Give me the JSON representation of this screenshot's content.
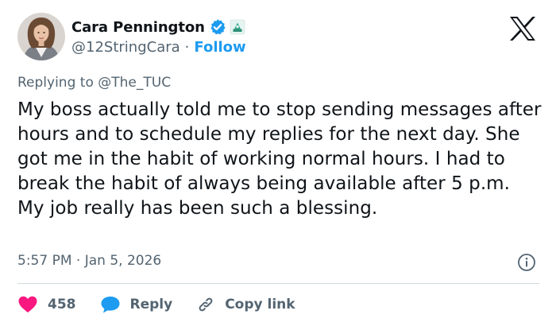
{
  "author": {
    "display_name": "Cara Pennington",
    "handle": "@12StringCara",
    "separator": "·",
    "follow_label": "Follow",
    "verified_color": "#1d9bf0"
  },
  "tweet": {
    "replying_prefix": "Replying to",
    "replying_handle": "@The_TUC",
    "text": "My boss actually told me to stop sending messages after hours and to schedule my replies for the next day. She got me in the habit of working normal hours. I had to break the habit of always being available after 5 p.m. My job really has been such a blessing.",
    "time": "5:57 PM",
    "meta_separator": "·",
    "date": "Jan 5, 2026"
  },
  "actions": {
    "like_count": "458",
    "reply_label": "Reply",
    "copy_label": "Copy link"
  },
  "icons": {
    "logo": "x-logo-icon",
    "verified": "verified-badge-icon",
    "affiliate": "affiliate-badge-icon",
    "info": "info-icon",
    "like": "heart-icon",
    "reply": "speech-bubble-icon",
    "copy": "link-icon"
  },
  "colors": {
    "accent": "#1d9bf0",
    "like": "#f91880",
    "text_primary": "#0f1419",
    "text_secondary": "#536471",
    "divider": "#cfd9de"
  }
}
